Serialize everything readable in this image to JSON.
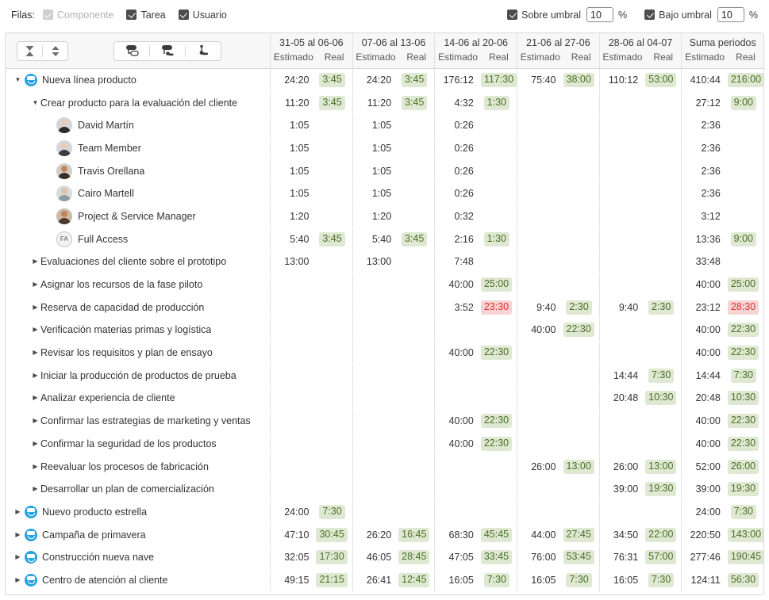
{
  "topbar": {
    "filas_label": "Filas:",
    "checkboxes": [
      {
        "label": "Componente",
        "checked": true,
        "disabled": true
      },
      {
        "label": "Tarea",
        "checked": true,
        "disabled": false
      },
      {
        "label": "Usuario",
        "checked": true,
        "disabled": false
      }
    ],
    "thresholds": [
      {
        "label": "Sobre umbral",
        "checked": true,
        "value": "10",
        "unit": "%"
      },
      {
        "label": "Bajo umbral",
        "checked": true,
        "value": "10",
        "unit": "%"
      }
    ]
  },
  "toolbar": {
    "collapse_icon": "hourglass-collapse-icon",
    "expand_icon": "up-down-expand-icon",
    "group_by_project_icon": "group-project-icon",
    "group_by_task_icon": "group-task-icon",
    "group_by_user_icon": "group-user-icon"
  },
  "header": {
    "back_arrow": "←",
    "sub_estimado": "Estimado",
    "sub_real": "Real",
    "periods": [
      "31-05 al 06-06",
      "07-06 al 13-06",
      "14-06 al 20-06",
      "21-06 al 27-06",
      "28-06 al 04-07",
      "Suma periodos"
    ]
  },
  "rows": [
    {
      "level": 0,
      "twist": "open",
      "icon": "project",
      "label": "Nueva línea producto",
      "cells": [
        {
          "est": "24:20",
          "real": "3:45",
          "state": "ok"
        },
        {
          "est": "24:20",
          "real": "3:45",
          "state": "ok"
        },
        {
          "est": "176:12",
          "real": "117:30",
          "state": "ok"
        },
        {
          "est": "75:40",
          "real": "38:00",
          "state": "ok"
        },
        {
          "est": "110:12",
          "real": "53:00",
          "state": "ok"
        },
        {
          "est": "410:44",
          "real": "216:00",
          "state": "ok"
        }
      ]
    },
    {
      "level": 1,
      "twist": "open",
      "icon": "none",
      "label": "Crear producto para la evaluación del cliente",
      "cells": [
        {
          "est": "11:20",
          "real": "3:45",
          "state": "ok"
        },
        {
          "est": "11:20",
          "real": "3:45",
          "state": "ok"
        },
        {
          "est": "4:32",
          "real": "1:30",
          "state": "ok"
        },
        {
          "est": "",
          "real": "",
          "state": "none"
        },
        {
          "est": "",
          "real": "",
          "state": "none"
        },
        {
          "est": "27:12",
          "real": "9:00",
          "state": "ok"
        }
      ]
    },
    {
      "level": 2,
      "twist": "none",
      "icon": "avatar",
      "avatar_kind": "photo-dark",
      "label": "David Martín",
      "cells": [
        {
          "est": "1:05",
          "real": "",
          "state": "none"
        },
        {
          "est": "1:05",
          "real": "",
          "state": "none"
        },
        {
          "est": "0:26",
          "real": "",
          "state": "none"
        },
        {
          "est": "",
          "real": "",
          "state": "none"
        },
        {
          "est": "",
          "real": "",
          "state": "none"
        },
        {
          "est": "2:36",
          "real": "",
          "state": "none"
        }
      ]
    },
    {
      "level": 2,
      "twist": "none",
      "icon": "avatar",
      "avatar_kind": "photo-light",
      "label": "Team Member",
      "cells": [
        {
          "est": "1:05",
          "real": "",
          "state": "none"
        },
        {
          "est": "1:05",
          "real": "",
          "state": "none"
        },
        {
          "est": "0:26",
          "real": "",
          "state": "none"
        },
        {
          "est": "",
          "real": "",
          "state": "none"
        },
        {
          "est": "",
          "real": "",
          "state": "none"
        },
        {
          "est": "2:36",
          "real": "",
          "state": "none"
        }
      ]
    },
    {
      "level": 2,
      "twist": "none",
      "icon": "avatar",
      "avatar_kind": "photo-tan",
      "label": "Travis Orellana",
      "cells": [
        {
          "est": "1:05",
          "real": "",
          "state": "none"
        },
        {
          "est": "1:05",
          "real": "",
          "state": "none"
        },
        {
          "est": "0:26",
          "real": "",
          "state": "none"
        },
        {
          "est": "",
          "real": "",
          "state": "none"
        },
        {
          "est": "",
          "real": "",
          "state": "none"
        },
        {
          "est": "2:36",
          "real": "",
          "state": "none"
        }
      ]
    },
    {
      "level": 2,
      "twist": "none",
      "icon": "avatar",
      "avatar_kind": "photo-grey",
      "label": "Cairo Martell",
      "cells": [
        {
          "est": "1:05",
          "real": "",
          "state": "none"
        },
        {
          "est": "1:05",
          "real": "",
          "state": "none"
        },
        {
          "est": "0:26",
          "real": "",
          "state": "none"
        },
        {
          "est": "",
          "real": "",
          "state": "none"
        },
        {
          "est": "",
          "real": "",
          "state": "none"
        },
        {
          "est": "2:36",
          "real": "",
          "state": "none"
        }
      ]
    },
    {
      "level": 2,
      "twist": "none",
      "icon": "avatar",
      "avatar_kind": "photo-warm",
      "label": "Project & Service Manager",
      "cells": [
        {
          "est": "1:20",
          "real": "",
          "state": "none"
        },
        {
          "est": "1:20",
          "real": "",
          "state": "none"
        },
        {
          "est": "0:32",
          "real": "",
          "state": "none"
        },
        {
          "est": "",
          "real": "",
          "state": "none"
        },
        {
          "est": "",
          "real": "",
          "state": "none"
        },
        {
          "est": "3:12",
          "real": "",
          "state": "none"
        }
      ]
    },
    {
      "level": 2,
      "twist": "none",
      "icon": "initials",
      "initials": "FA",
      "label": "Full Access",
      "cells": [
        {
          "est": "5:40",
          "real": "3:45",
          "state": "ok"
        },
        {
          "est": "5:40",
          "real": "3:45",
          "state": "ok"
        },
        {
          "est": "2:16",
          "real": "1:30",
          "state": "ok"
        },
        {
          "est": "",
          "real": "",
          "state": "none"
        },
        {
          "est": "",
          "real": "",
          "state": "none"
        },
        {
          "est": "13:36",
          "real": "9:00",
          "state": "ok"
        }
      ]
    },
    {
      "level": 1,
      "twist": "closed",
      "icon": "none",
      "label": "Evaluaciones del cliente sobre el prototipo",
      "cells": [
        {
          "est": "13:00",
          "real": "",
          "state": "none"
        },
        {
          "est": "13:00",
          "real": "",
          "state": "none"
        },
        {
          "est": "7:48",
          "real": "",
          "state": "none"
        },
        {
          "est": "",
          "real": "",
          "state": "none"
        },
        {
          "est": "",
          "real": "",
          "state": "none"
        },
        {
          "est": "33:48",
          "real": "",
          "state": "none"
        }
      ]
    },
    {
      "level": 1,
      "twist": "closed",
      "icon": "none",
      "label": "Asignar los recursos de la fase piloto",
      "cells": [
        {
          "est": "",
          "real": "",
          "state": "none"
        },
        {
          "est": "",
          "real": "",
          "state": "none"
        },
        {
          "est": "40:00",
          "real": "25:00",
          "state": "ok"
        },
        {
          "est": "",
          "real": "",
          "state": "none"
        },
        {
          "est": "",
          "real": "",
          "state": "none"
        },
        {
          "est": "40:00",
          "real": "25:00",
          "state": "ok"
        }
      ]
    },
    {
      "level": 1,
      "twist": "closed",
      "icon": "none",
      "label": "Reserva de capacidad de producción",
      "cells": [
        {
          "est": "",
          "real": "",
          "state": "none"
        },
        {
          "est": "",
          "real": "",
          "state": "none"
        },
        {
          "est": "3:52",
          "real": "23:30",
          "state": "over"
        },
        {
          "est": "9:40",
          "real": "2:30",
          "state": "ok"
        },
        {
          "est": "9:40",
          "real": "2:30",
          "state": "ok"
        },
        {
          "est": "23:12",
          "real": "28:30",
          "state": "over"
        }
      ]
    },
    {
      "level": 1,
      "twist": "closed",
      "icon": "none",
      "label": "Verificación materias primas y logística",
      "cells": [
        {
          "est": "",
          "real": "",
          "state": "none"
        },
        {
          "est": "",
          "real": "",
          "state": "none"
        },
        {
          "est": "",
          "real": "",
          "state": "none"
        },
        {
          "est": "40:00",
          "real": "22:30",
          "state": "ok"
        },
        {
          "est": "",
          "real": "",
          "state": "none"
        },
        {
          "est": "40:00",
          "real": "22:30",
          "state": "ok"
        }
      ]
    },
    {
      "level": 1,
      "twist": "closed",
      "icon": "none",
      "label": "Revisar los requisitos y plan de ensayo",
      "cells": [
        {
          "est": "",
          "real": "",
          "state": "none"
        },
        {
          "est": "",
          "real": "",
          "state": "none"
        },
        {
          "est": "40:00",
          "real": "22:30",
          "state": "ok"
        },
        {
          "est": "",
          "real": "",
          "state": "none"
        },
        {
          "est": "",
          "real": "",
          "state": "none"
        },
        {
          "est": "40:00",
          "real": "22:30",
          "state": "ok"
        }
      ]
    },
    {
      "level": 1,
      "twist": "closed",
      "icon": "none",
      "label": "Iniciar la producción de productos de prueba",
      "cells": [
        {
          "est": "",
          "real": "",
          "state": "none"
        },
        {
          "est": "",
          "real": "",
          "state": "none"
        },
        {
          "est": "",
          "real": "",
          "state": "none"
        },
        {
          "est": "",
          "real": "",
          "state": "none"
        },
        {
          "est": "14:44",
          "real": "7:30",
          "state": "ok"
        },
        {
          "est": "14:44",
          "real": "7:30",
          "state": "ok"
        }
      ]
    },
    {
      "level": 1,
      "twist": "closed",
      "icon": "none",
      "label": "Analizar experiencia de cliente",
      "cells": [
        {
          "est": "",
          "real": "",
          "state": "none"
        },
        {
          "est": "",
          "real": "",
          "state": "none"
        },
        {
          "est": "",
          "real": "",
          "state": "none"
        },
        {
          "est": "",
          "real": "",
          "state": "none"
        },
        {
          "est": "20:48",
          "real": "10:30",
          "state": "ok"
        },
        {
          "est": "20:48",
          "real": "10:30",
          "state": "ok"
        }
      ]
    },
    {
      "level": 1,
      "twist": "closed",
      "icon": "none",
      "label": "Confirmar las estrategias de marketing y ventas",
      "cells": [
        {
          "est": "",
          "real": "",
          "state": "none"
        },
        {
          "est": "",
          "real": "",
          "state": "none"
        },
        {
          "est": "40:00",
          "real": "22:30",
          "state": "ok"
        },
        {
          "est": "",
          "real": "",
          "state": "none"
        },
        {
          "est": "",
          "real": "",
          "state": "none"
        },
        {
          "est": "40:00",
          "real": "22:30",
          "state": "ok"
        }
      ]
    },
    {
      "level": 1,
      "twist": "closed",
      "icon": "none",
      "label": "Confirmar la seguridad de los productos",
      "cells": [
        {
          "est": "",
          "real": "",
          "state": "none"
        },
        {
          "est": "",
          "real": "",
          "state": "none"
        },
        {
          "est": "40:00",
          "real": "22:30",
          "state": "ok"
        },
        {
          "est": "",
          "real": "",
          "state": "none"
        },
        {
          "est": "",
          "real": "",
          "state": "none"
        },
        {
          "est": "40:00",
          "real": "22:30",
          "state": "ok"
        }
      ]
    },
    {
      "level": 1,
      "twist": "closed",
      "icon": "none",
      "label": "Reevaluar los procesos de fabricación",
      "cells": [
        {
          "est": "",
          "real": "",
          "state": "none"
        },
        {
          "est": "",
          "real": "",
          "state": "none"
        },
        {
          "est": "",
          "real": "",
          "state": "none"
        },
        {
          "est": "26:00",
          "real": "13:00",
          "state": "ok"
        },
        {
          "est": "26:00",
          "real": "13:00",
          "state": "ok"
        },
        {
          "est": "52:00",
          "real": "26:00",
          "state": "ok"
        }
      ]
    },
    {
      "level": 1,
      "twist": "closed",
      "icon": "none",
      "label": "Desarrollar un plan de comercialización",
      "cells": [
        {
          "est": "",
          "real": "",
          "state": "none"
        },
        {
          "est": "",
          "real": "",
          "state": "none"
        },
        {
          "est": "",
          "real": "",
          "state": "none"
        },
        {
          "est": "",
          "real": "",
          "state": "none"
        },
        {
          "est": "39:00",
          "real": "19:30",
          "state": "ok"
        },
        {
          "est": "39:00",
          "real": "19:30",
          "state": "ok"
        }
      ]
    },
    {
      "level": 0,
      "twist": "closed",
      "icon": "project",
      "label": "Nuevo producto estrella",
      "cells": [
        {
          "est": "24:00",
          "real": "7:30",
          "state": "ok"
        },
        {
          "est": "",
          "real": "",
          "state": "none"
        },
        {
          "est": "",
          "real": "",
          "state": "none"
        },
        {
          "est": "",
          "real": "",
          "state": "none"
        },
        {
          "est": "",
          "real": "",
          "state": "none"
        },
        {
          "est": "24:00",
          "real": "7:30",
          "state": "ok"
        }
      ]
    },
    {
      "level": 0,
      "twist": "closed",
      "icon": "project",
      "label": "Campaña de primavera",
      "cells": [
        {
          "est": "47:10",
          "real": "30:45",
          "state": "ok"
        },
        {
          "est": "26:20",
          "real": "16:45",
          "state": "ok"
        },
        {
          "est": "68:30",
          "real": "45:45",
          "state": "ok"
        },
        {
          "est": "44:00",
          "real": "27:45",
          "state": "ok"
        },
        {
          "est": "34:50",
          "real": "22:00",
          "state": "ok"
        },
        {
          "est": "220:50",
          "real": "143:00",
          "state": "ok"
        }
      ]
    },
    {
      "level": 0,
      "twist": "closed",
      "icon": "project",
      "label": "Construcción nueva nave",
      "cells": [
        {
          "est": "32:05",
          "real": "17:30",
          "state": "ok"
        },
        {
          "est": "46:05",
          "real": "28:45",
          "state": "ok"
        },
        {
          "est": "47:05",
          "real": "33:45",
          "state": "ok"
        },
        {
          "est": "76:00",
          "real": "53:45",
          "state": "ok"
        },
        {
          "est": "76:31",
          "real": "57:00",
          "state": "ok"
        },
        {
          "est": "277:46",
          "real": "190:45",
          "state": "ok"
        }
      ]
    },
    {
      "level": 0,
      "twist": "closed",
      "icon": "project",
      "label": "Centro de atención al cliente",
      "cells": [
        {
          "est": "49:15",
          "real": "21:15",
          "state": "ok"
        },
        {
          "est": "26:41",
          "real": "12:45",
          "state": "ok"
        },
        {
          "est": "16:05",
          "real": "7:30",
          "state": "ok"
        },
        {
          "est": "16:05",
          "real": "7:30",
          "state": "ok"
        },
        {
          "est": "16:05",
          "real": "7:30",
          "state": "ok"
        },
        {
          "est": "124:11",
          "real": "56:30",
          "state": "ok"
        }
      ]
    }
  ],
  "colors": {
    "ok_bg": "#dfe8d3",
    "ok_text": "#4a7024",
    "over_bg": "#f7d4d4",
    "over_text": "#e03030",
    "project_icon": "#29a3e0",
    "header_bg": "#f7f7f7"
  }
}
